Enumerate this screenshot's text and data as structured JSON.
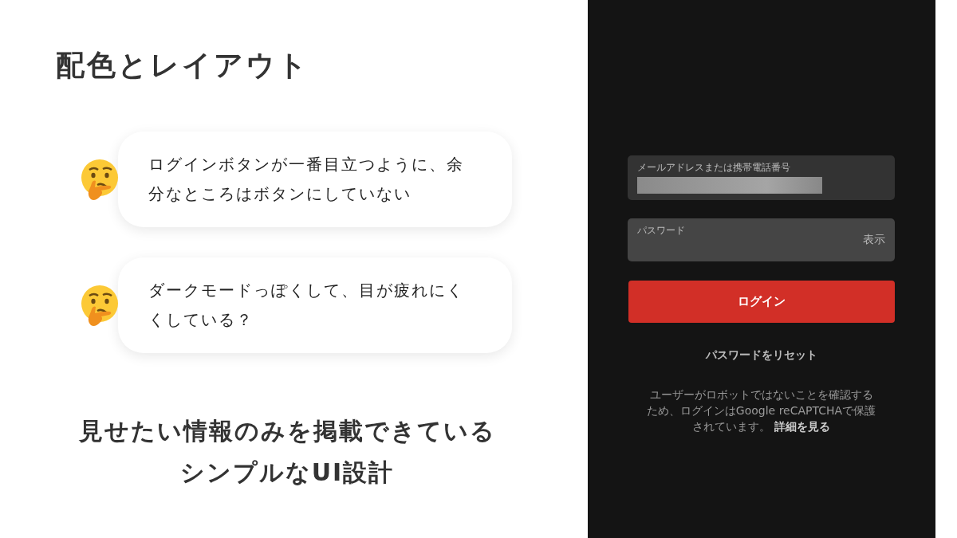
{
  "slide": {
    "title": "配色とレイアウト",
    "points": [
      {
        "text": "ログインボタンが一番目立つように、余分なところはボタンにしていない"
      },
      {
        "text": "ダークモードっぽくして、目が疲れにくくしている？"
      }
    ],
    "summary": [
      "見せたい情報のみを掲載できている",
      "シンプルなUI設計"
    ]
  },
  "login_screen": {
    "fields": [
      {
        "kind": "redacted",
        "label": "メールアドレスまたは携帯電話番号"
      },
      {
        "kind": "password",
        "label": "パスワード",
        "toggle": "表示"
      }
    ],
    "login_button": "ログイン",
    "reset_link": "パスワードをリセット",
    "notice": "ユーザーがロボットではないことを確認するため、ログインはGoogle reCAPTCHAで保護されています。",
    "notice_link": "詳細を見る"
  }
}
